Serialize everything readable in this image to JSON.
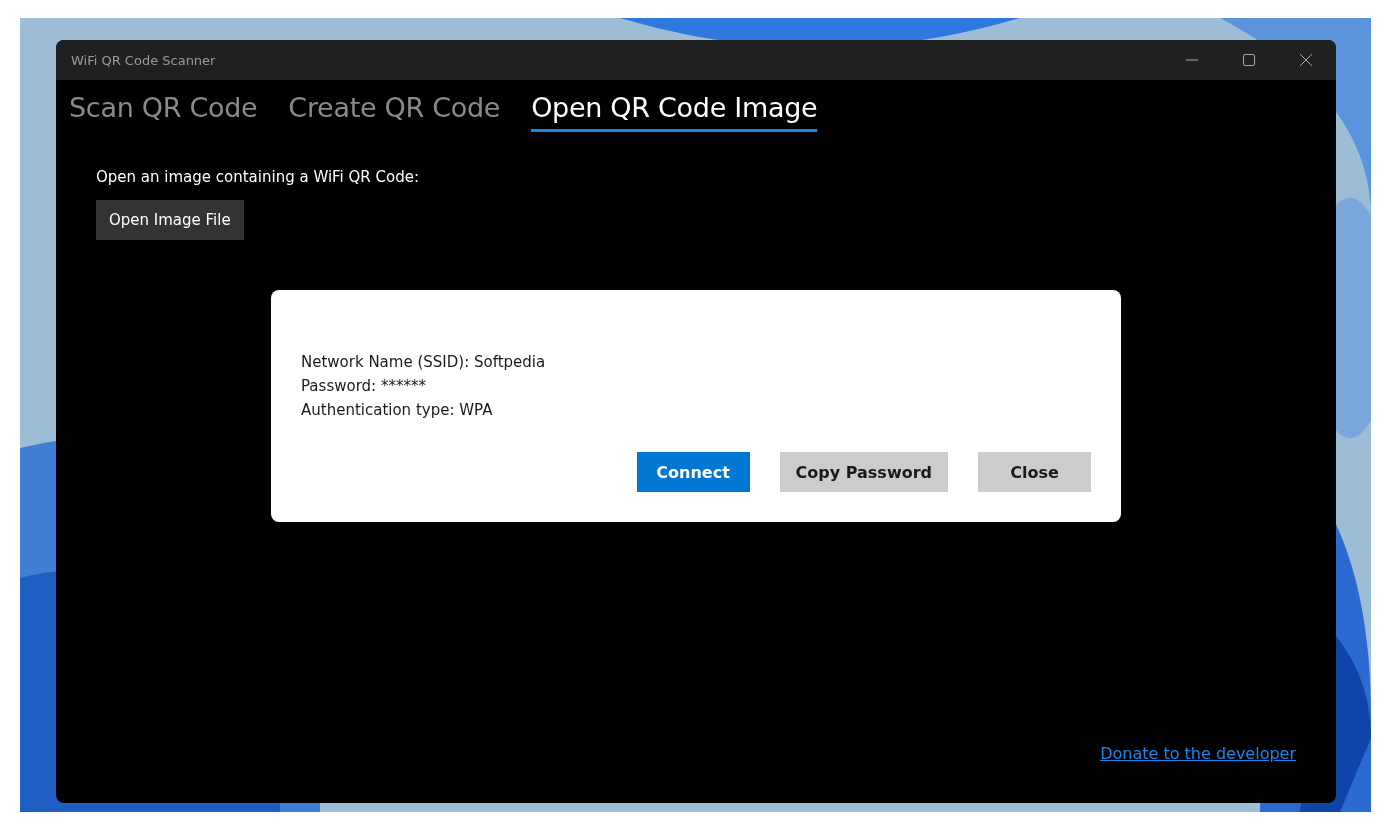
{
  "window": {
    "title": "WiFi QR Code Scanner"
  },
  "tabs": [
    {
      "label": "Scan QR Code",
      "selected": false
    },
    {
      "label": "Create QR Code",
      "selected": false
    },
    {
      "label": "Open QR Code Image",
      "selected": true
    }
  ],
  "open_image": {
    "prompt": "Open an image containing a WiFi QR Code:",
    "button": "Open Image File"
  },
  "dialog": {
    "lines": [
      "Network Name (SSID): Softpedia",
      "Password: ******",
      "Authentication type: WPA"
    ],
    "buttons": [
      {
        "label": "Connect",
        "kind": "primary"
      },
      {
        "label": "Copy Password",
        "kind": "secondary"
      },
      {
        "label": "Close",
        "kind": "secondary"
      }
    ]
  },
  "footer": {
    "link": "Donate to the developer"
  }
}
